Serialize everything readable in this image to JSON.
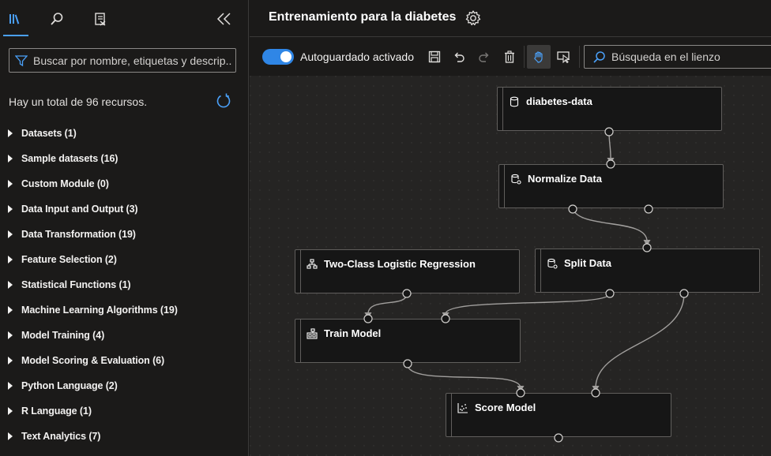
{
  "left_panel": {
    "tabs": [
      {
        "icon": "library-icon",
        "active": true
      },
      {
        "icon": "search-icon",
        "active": false
      },
      {
        "icon": "clipboard-icon",
        "active": false
      }
    ],
    "collapse_icon": "double-chevron-left-icon",
    "search_placeholder": "Buscar por nombre, etiquetas y descrip...",
    "total_text": "Hay un total de 96 recursos.",
    "categories": [
      "Datasets (1)",
      "Sample datasets (16)",
      "Custom Module (0)",
      "Data Input and Output (3)",
      "Data Transformation (19)",
      "Feature Selection (2)",
      "Statistical Functions (1)",
      "Machine Learning Algorithms (19)",
      "Model Training (4)",
      "Model Scoring & Evaluation (6)",
      "Python Language (2)",
      "R Language (1)",
      "Text Analytics (7)"
    ]
  },
  "header": {
    "title": "Entrenamiento para la diabetes",
    "settings_icon": "gear-icon"
  },
  "toolbar": {
    "autosave_label": "Autoguardado activado",
    "autosave_on": true,
    "canvas_search_placeholder": "Búsqueda en el lienzo"
  },
  "canvas": {
    "nodes": [
      {
        "id": "diabetes-data",
        "label": "diabetes-data",
        "icon": "dataset-icon"
      },
      {
        "id": "normalize",
        "label": "Normalize Data",
        "icon": "data-transform-icon"
      },
      {
        "id": "logreg",
        "label": "Two-Class Logistic Regression",
        "icon": "algorithm-icon"
      },
      {
        "id": "split",
        "label": "Split Data",
        "icon": "data-transform-icon"
      },
      {
        "id": "train",
        "label": "Train Model",
        "icon": "train-icon"
      },
      {
        "id": "score",
        "label": "Score Model",
        "icon": "score-icon"
      }
    ]
  },
  "colors": {
    "accent": "#4aa0f8",
    "toggle": "#2f86e6",
    "canvas_bg": "#252423",
    "node_bg": "#161616"
  }
}
